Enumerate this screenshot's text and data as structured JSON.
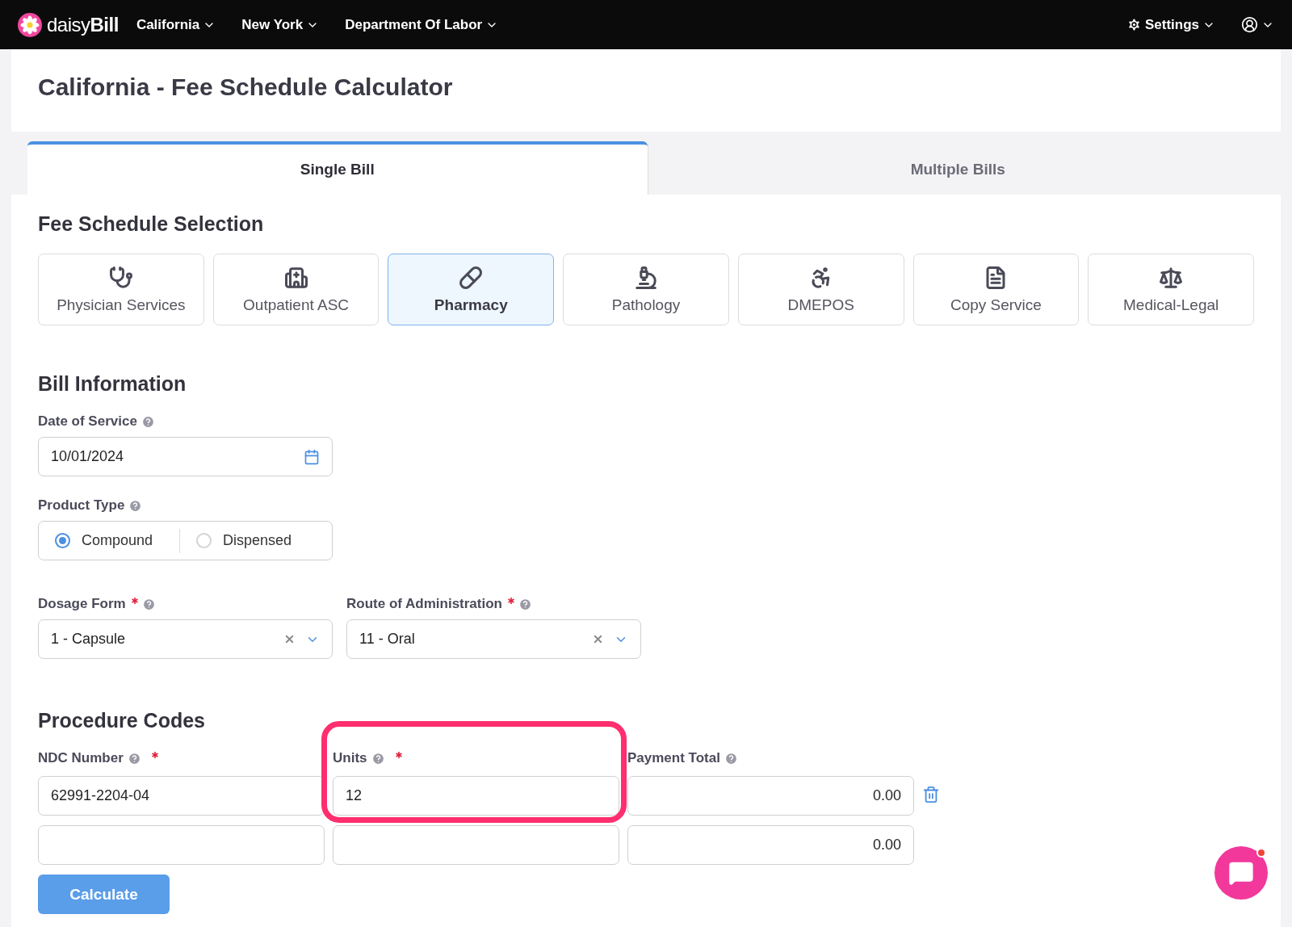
{
  "nav": {
    "logo": {
      "light": "daisy",
      "bold": "Bill"
    },
    "menus": [
      "California",
      "New York",
      "Department Of Labor"
    ],
    "settings": "Settings"
  },
  "page_title": "California - Fee Schedule Calculator",
  "tabs": [
    {
      "label": "Single Bill",
      "selected": true
    },
    {
      "label": "Multiple Bills",
      "selected": false
    }
  ],
  "fee_schedule": {
    "heading": "Fee Schedule Selection",
    "options": [
      {
        "label": "Physician Services",
        "selected": false
      },
      {
        "label": "Outpatient ASC",
        "selected": false
      },
      {
        "label": "Pharmacy",
        "selected": true
      },
      {
        "label": "Pathology",
        "selected": false
      },
      {
        "label": "DMEPOS",
        "selected": false
      },
      {
        "label": "Copy Service",
        "selected": false
      },
      {
        "label": "Medical-Legal",
        "selected": false
      }
    ]
  },
  "bill_information": {
    "heading": "Bill Information",
    "date_of_service": {
      "label": "Date of Service",
      "value": "10/01/2024"
    },
    "product_type": {
      "label": "Product Type",
      "options": [
        {
          "label": "Compound",
          "selected": true
        },
        {
          "label": "Dispensed",
          "selected": false
        }
      ]
    },
    "selects": [
      {
        "label": "Dosage Form",
        "required": true,
        "value": "1 - Capsule"
      },
      {
        "label": "Route of Administration",
        "required": true,
        "value": "11 - Oral"
      }
    ]
  },
  "procedure_codes": {
    "heading": "Procedure Codes",
    "columns": [
      {
        "label": "NDC Number",
        "required": true,
        "help": true,
        "highlighted": false
      },
      {
        "label": "Units",
        "required": true,
        "help": true,
        "highlighted": true
      },
      {
        "label": "Payment Total",
        "required": false,
        "help": true,
        "highlighted": false
      }
    ],
    "rows": [
      {
        "ndc": "62991-2204-04",
        "units": "12",
        "payment": "0.00",
        "deletable": true
      },
      {
        "ndc": "",
        "units": "",
        "payment": "0.00",
        "deletable": false
      }
    ],
    "calculate": "Calculate"
  },
  "chat": {
    "unread": true
  }
}
